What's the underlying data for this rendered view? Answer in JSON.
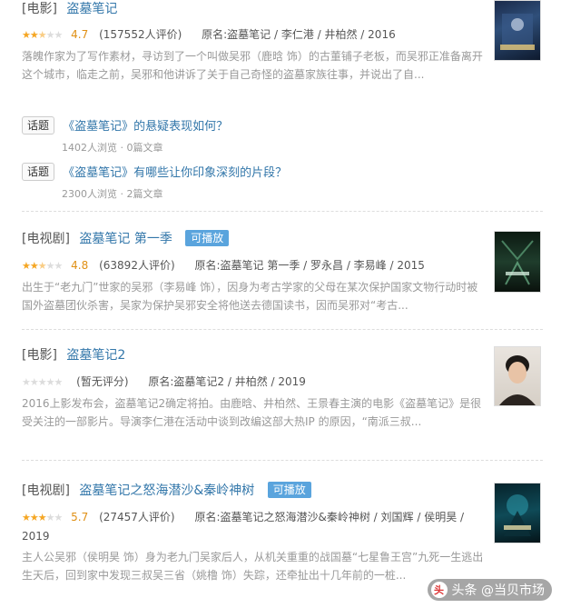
{
  "colors": {
    "link": "#3377aa",
    "badge": "#5aa4dd",
    "star": "#f5a623",
    "rating": "#e09015"
  },
  "results": [
    {
      "category": "[电影]",
      "title": "盗墓笔记",
      "playable": false,
      "stars": 2.5,
      "rating": "4.7",
      "count": "(157552人评价)",
      "origin": "原名:盗墓笔记 / 李仁港 / 井柏然 / 2016",
      "description": "落魄作家为了写作素材，寻访到了一个叫做吴邪（鹿晗 饰）的古董铺子老板，而吴邪正准备离开这个城市，临走之前，吴邪和他讲诉了关于自己奇怪的盗墓家族往事，并说出了自...",
      "poster_icon": "poster-dark-blue"
    },
    {
      "category": "[电视剧]",
      "title": "盗墓笔记 第一季",
      "playable": true,
      "badge": "可播放",
      "stars": 2.5,
      "rating": "4.8",
      "count": "(63892人评价)",
      "origin": "原名:盗墓笔记 第一季 / 罗永昌 / 李易峰 / 2015",
      "description": "出生于“老九门”世家的吴邪（李易峰 饰），因身为考古学家的父母在某次保护国家文物行动时被国外盗墓团伙杀害，吴家为保护吴邪安全将他送去德国读书，因而吴邪对“考古...",
      "poster_icon": "poster-dark-green"
    },
    {
      "category": "[电影]",
      "title": "盗墓笔记2",
      "playable": false,
      "stars": 0,
      "rating": "",
      "count": "(暂无评分)",
      "origin": "原名:盗墓笔记2 / 井柏然 / 2019",
      "description": "2016上影发布会，盗墓笔记2确定将拍。由鹿晗、井柏然、王景春主演的电影《盗墓笔记》是很受关注的一部影片。导演李仁港在活动中谈到改编这部大热IP 的原因，“南派三叔...",
      "poster_icon": "poster-portrait"
    },
    {
      "category": "[电视剧]",
      "title": "盗墓笔记之怒海潜沙&秦岭神树",
      "playable": true,
      "badge": "可播放",
      "stars": 3,
      "rating": "5.7",
      "count": "(27457人评价)",
      "origin": "原名:盗墓笔记之怒海潜沙&秦岭神树 / 刘国辉 / 侯明昊 /",
      "origin_2": "2019",
      "description": "主人公吴邪（侯明昊 饰）身为老九门吴家后人，从机关重重的战国墓“七星鲁王宫”九死一生逃出生天后，回到家中发现三叔吴三省（姚橹 饰）失踪，还牵扯出十几年前的一桩...",
      "poster_icon": "poster-teal"
    }
  ],
  "topics": [
    {
      "tag": "话题",
      "title": "《盗墓笔记》的悬疑表现如何？",
      "meta": "1402人浏览 · 0篇文章"
    },
    {
      "tag": "话题",
      "title": "《盗墓笔记》有哪些让你印象深刻的片段？",
      "meta": "2300人浏览 · 2篇文章"
    }
  ],
  "watermark": {
    "logo": "头",
    "text": "头条 @当贝市场"
  }
}
